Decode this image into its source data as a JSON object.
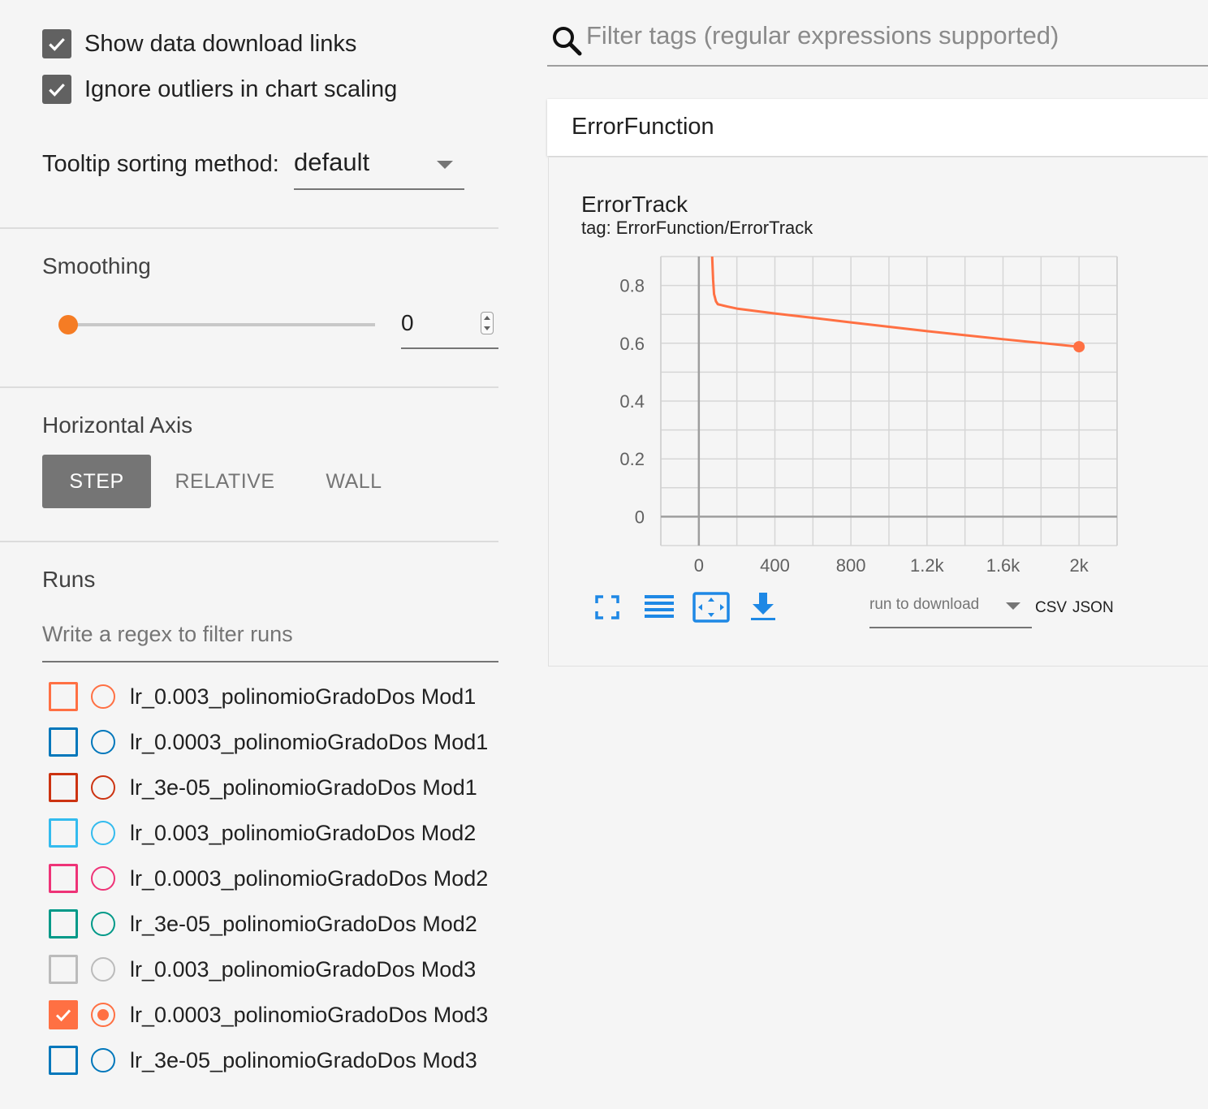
{
  "sidebar": {
    "show_download_links": {
      "label": "Show data download links",
      "checked": true
    },
    "ignore_outliers": {
      "label": "Ignore outliers in chart scaling",
      "checked": true
    },
    "tooltip_sorting": {
      "label": "Tooltip sorting method:",
      "value": "default"
    },
    "smoothing": {
      "title": "Smoothing",
      "value": "0",
      "slider_value": 0
    },
    "horizontal_axis": {
      "title": "Horizontal Axis",
      "options": [
        {
          "label": "STEP",
          "active": true
        },
        {
          "label": "RELATIVE",
          "active": false
        },
        {
          "label": "WALL",
          "active": false
        }
      ]
    },
    "runs": {
      "title": "Runs",
      "filter_placeholder": "Write a regex to filter runs",
      "items": [
        {
          "label": "lr_0.003_polinomioGradoDos Mod1",
          "color": "#ff7043",
          "checked": false
        },
        {
          "label": "lr_0.0003_polinomioGradoDos Mod1",
          "color": "#0077bb",
          "checked": false
        },
        {
          "label": "lr_3e-05_polinomioGradoDos Mod1",
          "color": "#cc3311",
          "checked": false
        },
        {
          "label": "lr_0.003_polinomioGradoDos Mod2",
          "color": "#33bbee",
          "checked": false
        },
        {
          "label": "lr_0.0003_polinomioGradoDos Mod2",
          "color": "#ee3377",
          "checked": false
        },
        {
          "label": "lr_3e-05_polinomioGradoDos Mod2",
          "color": "#009988",
          "checked": false
        },
        {
          "label": "lr_0.003_polinomioGradoDos Mod3",
          "color": "#bbbbbb",
          "checked": false
        },
        {
          "label": "lr_0.0003_polinomioGradoDos Mod3",
          "color": "#ff7043",
          "checked": true
        },
        {
          "label": "lr_3e-05_polinomioGradoDos Mod3",
          "color": "#0077bb",
          "checked": false
        }
      ]
    }
  },
  "main": {
    "search_placeholder": "Filter tags (regular expressions supported)",
    "category": "ErrorFunction",
    "card": {
      "title": "ErrorTrack",
      "tag": "tag: ErrorFunction/ErrorTrack",
      "download_placeholder": "run to download",
      "csv_label": "CSV",
      "json_label": "JSON"
    }
  },
  "icons": {
    "expand": "fullscreen-icon",
    "log_scale": "lines-icon",
    "fit_domain": "fit-domain-icon",
    "download": "download-icon"
  },
  "chart_data": {
    "type": "line",
    "title": "ErrorTrack",
    "xlabel": "",
    "ylabel": "",
    "xlim": [
      -200,
      2200
    ],
    "ylim": [
      -0.1,
      0.9
    ],
    "x_ticks": [
      0,
      400,
      800,
      1200,
      1600,
      2000
    ],
    "x_tick_labels": [
      "0",
      "400",
      "800",
      "1.2k",
      "1.6k",
      "2k"
    ],
    "y_ticks": [
      0,
      0.2,
      0.4,
      0.6,
      0.8
    ],
    "y_tick_labels": [
      "0",
      "0.2",
      "0.4",
      "0.6",
      "0.8"
    ],
    "grid": true,
    "series": [
      {
        "color": "#ff7043",
        "x": [
          70,
          75,
          80,
          90,
          100,
          150,
          200,
          400,
          600,
          800,
          1000,
          1200,
          1400,
          1600,
          1800,
          2000
        ],
        "y": [
          0.9,
          0.82,
          0.77,
          0.745,
          0.735,
          0.727,
          0.72,
          0.703,
          0.688,
          0.672,
          0.657,
          0.642,
          0.628,
          0.614,
          0.601,
          0.588
        ]
      }
    ]
  }
}
